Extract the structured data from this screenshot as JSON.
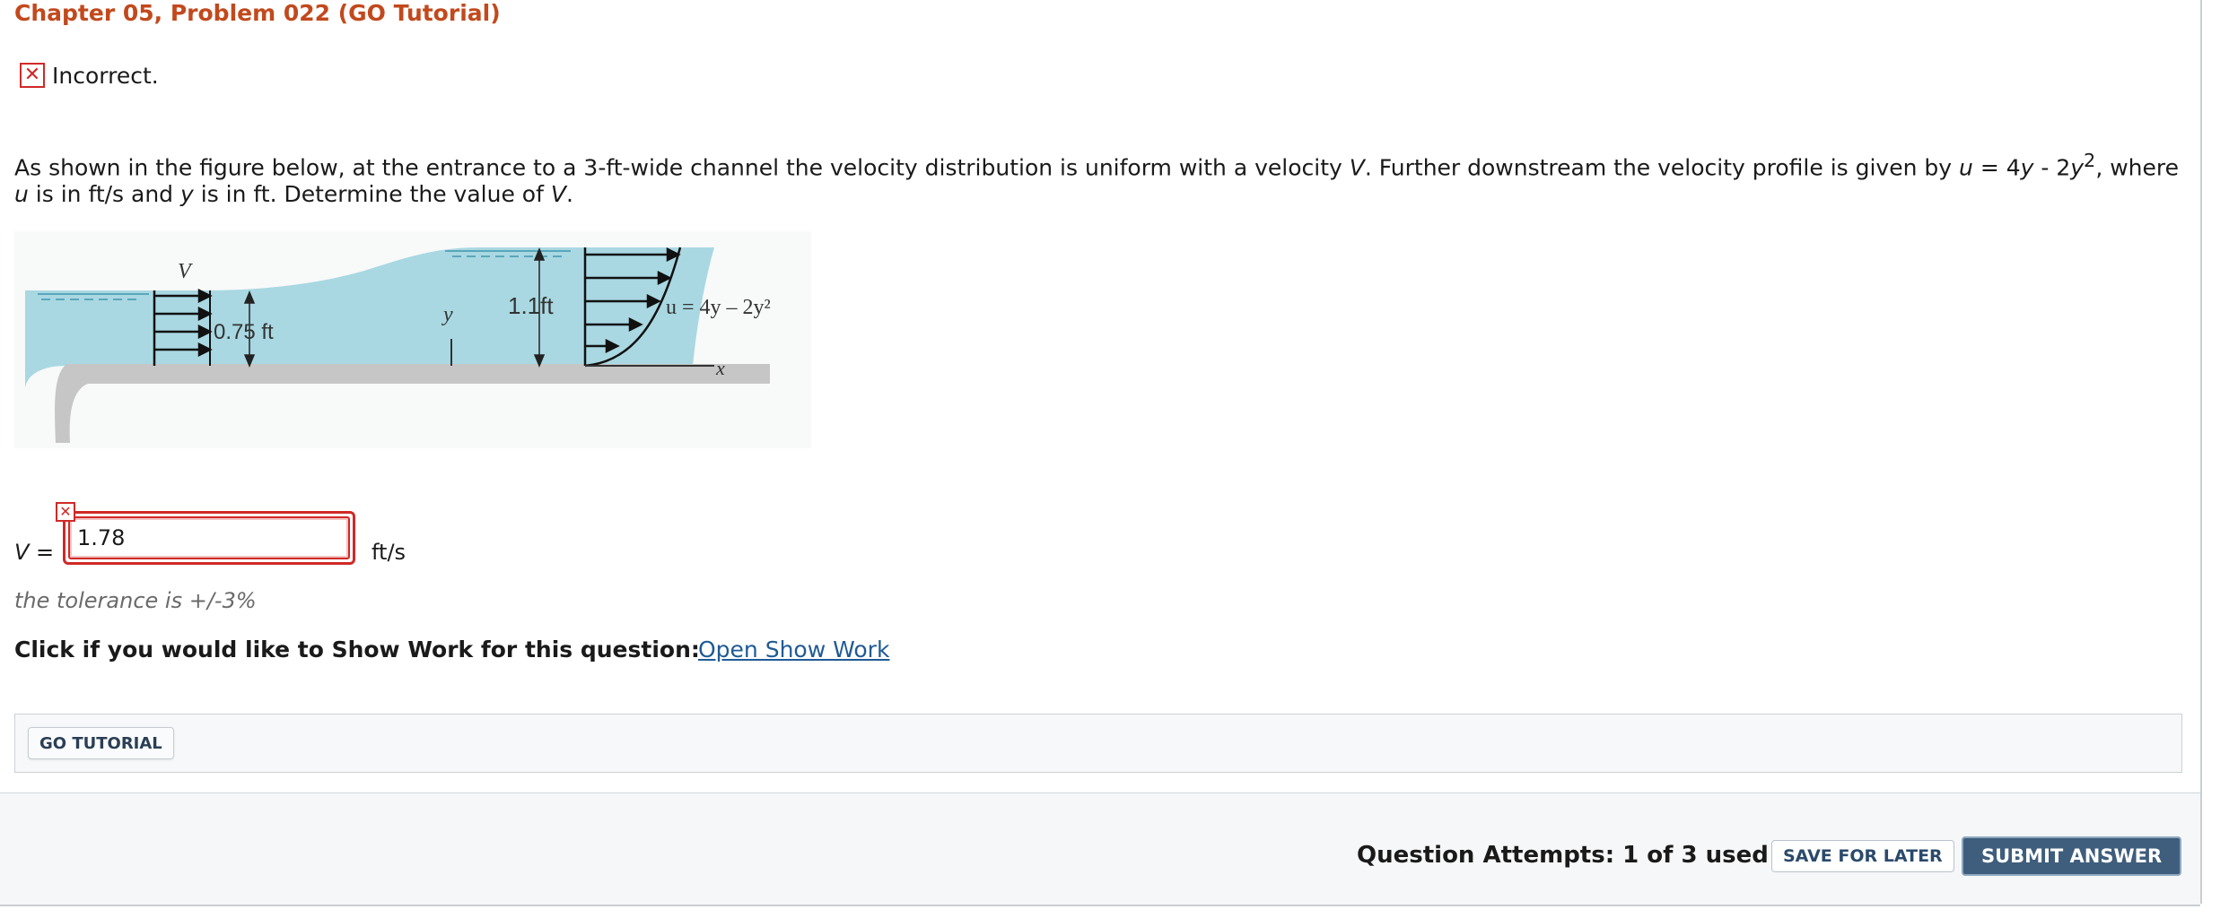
{
  "header": {
    "title": "Chapter 05, Problem 022 (GO Tutorial)"
  },
  "feedback": {
    "icon": "close-icon",
    "text": "Incorrect.",
    "color": "#cf2a27"
  },
  "problem": {
    "p1": "As shown in the figure below, at the entrance to a 3-ft-wide channel the velocity distribution is uniform with a velocity ",
    "V": "V",
    "p2": ". Further downstream the velocity profile is given by ",
    "u": "u",
    "eq1": " = 4",
    "y1": "y",
    "eq2": " - 2",
    "y2": "y",
    "sup": "2",
    "p3": ", where ",
    "u2": "u",
    "p4": " is in ft/s and ",
    "y3": "y",
    "p5": " is in ft. Determine the value of ",
    "V2": "V",
    "p6": "."
  },
  "figure": {
    "label_V": "V",
    "label_075": "0.75 ft",
    "label_y": "y",
    "label_11": "1.1ft",
    "label_eq": "u = 4y – 2y²",
    "label_x": "x",
    "water_color": "#a9d8e2",
    "bed_color": "#c6c6c6"
  },
  "answer": {
    "variable": "V =",
    "value": "1.78",
    "unit": "ft/s",
    "error_icon": "close-icon"
  },
  "tolerance": "the tolerance is +/-3%",
  "show_work": {
    "prompt": "Click if you would like to Show Work for this question:",
    "link": "Open Show Work"
  },
  "tutorial": {
    "button": "GO TUTORIAL"
  },
  "footer": {
    "attempts": "Question Attempts: 1 of 3 used",
    "save": "SAVE FOR LATER",
    "submit": "SUBMIT ANSWER"
  }
}
